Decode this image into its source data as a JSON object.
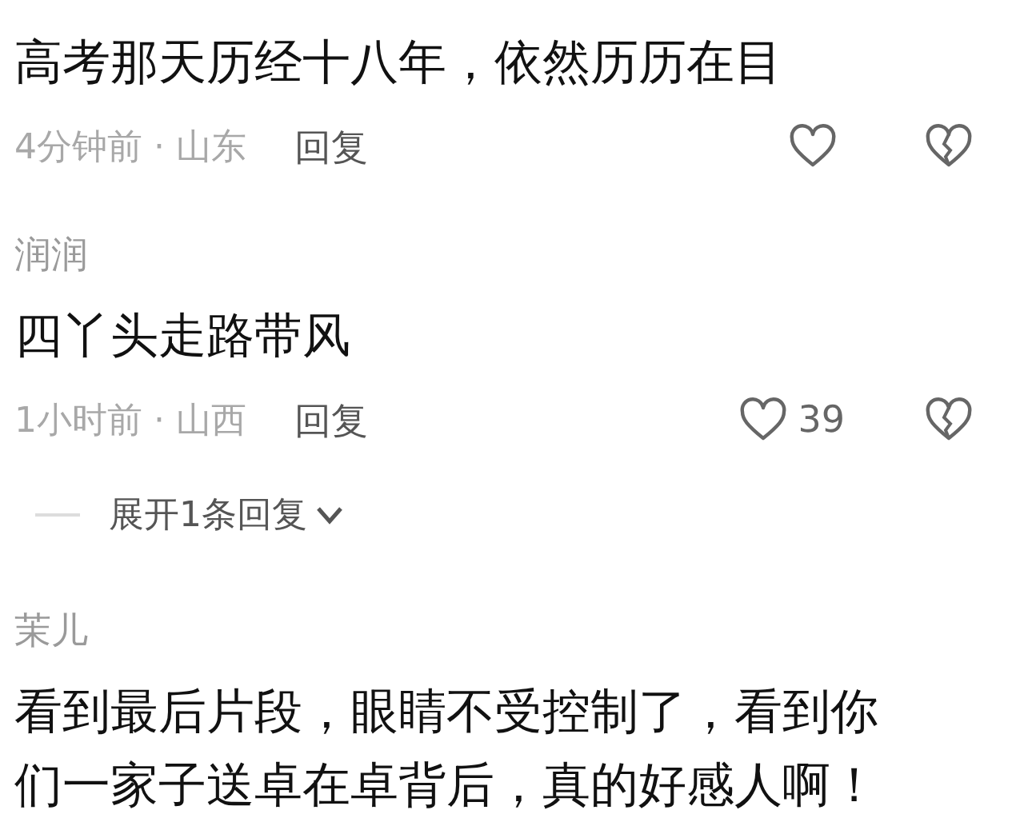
{
  "comments": [
    {
      "text": "高考那天历经十八年，依然历历在目",
      "meta": "4分钟前 · 山东",
      "reply_label": "回复"
    },
    {
      "author": "润润",
      "text": "四丫头走路带风",
      "meta": "1小时前 · 山西",
      "reply_label": "回复",
      "likes": "39",
      "replies_toggle": "展开1条回复"
    },
    {
      "author": "茉儿",
      "text": "看到最后片段，眼睛不受控制了，看到你们一家子送卓在卓背后，真的好感人啊！"
    }
  ]
}
